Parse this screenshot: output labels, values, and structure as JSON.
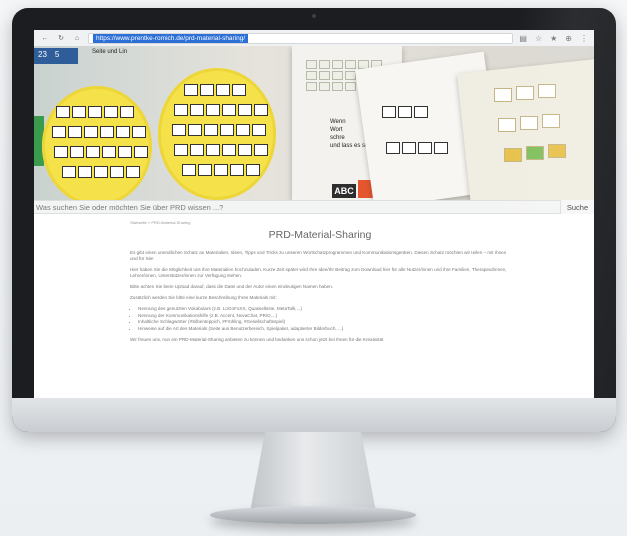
{
  "browser": {
    "url": "https://www.prentke-romich.de/prd-material-sharing/",
    "back_glyph": "←",
    "reload_glyph": "↻",
    "home_glyph": "⌂",
    "bar_icons": [
      "▤",
      "☆",
      "★",
      "⊕",
      "⋮"
    ]
  },
  "hero": {
    "tile_numbers": [
      "23",
      "5"
    ],
    "text_lines": [
      "Wenn",
      "Wort",
      "schre",
      "und lass es suchen."
    ],
    "small_caption": "Seite und Lin",
    "abc_label": "ABC"
  },
  "search": {
    "placeholder": "Was suchen Sie oder möchten Sie über PRD wissen ...?",
    "button_label": "Suche"
  },
  "page": {
    "breadcrumb": "Startseite » PRD-Material-Sharing",
    "title": "PRD-Material-Sharing",
    "paragraphs": [
      "Es gibt einen unendlichen Schatz an Materialien, Ideen, Tipps und Tricks zu unseren Wortschatzprogrammen und Kommunikationsgeräten. Diesen Schatz möchten wir teilen – mit Ihnen und für Sie!",
      "Hier haben Sie die Möglichkeit uns ihre Materialien hochzuladen. Kurze Zeit später wird Ihre Idee/Ihr Beitrag zum Download hier für alle Nutzer/innen und ihre Familien, Therapeut/innen, Lehrer/innen, Unterstützer/innen zur Verfügung stehen.",
      "Bitte achten Sie beim Upload darauf, dass die Datei und der Autor einen eindeutigen Namen haben.",
      "Zusätzlich werden Sie bitte eine kurze Beschreibung Ihres Materials mit:"
    ],
    "bullets": [
      "Nennung des genutzten Vokabulars (z.B. LoGoFoXX, Quasselkiste, MetaTalk,...)",
      "Nennung der Kommunikationshilfe (z.B. Accent, NovaChat, PRiO,...)",
      "Inhaltliche Schlagwörter (#Silbenteppich, #Frühling, #Gesellschaftsspiel)",
      "Hinweise auf die Art des Materials (Seite aus Benutzerbereich, Spielpaket, adaptierter Bilderbuch, ...)"
    ],
    "closing": "Wir freuen uns, nun ein PRD-Material-Sharing anbieten zu können und bedanken uns schon jetzt bei Ihnen für die Kreativität"
  },
  "colors": {
    "plate_yellow": "#f5e24a",
    "url_highlight": "#2c6fd6",
    "bezel": "#1b1d20"
  }
}
